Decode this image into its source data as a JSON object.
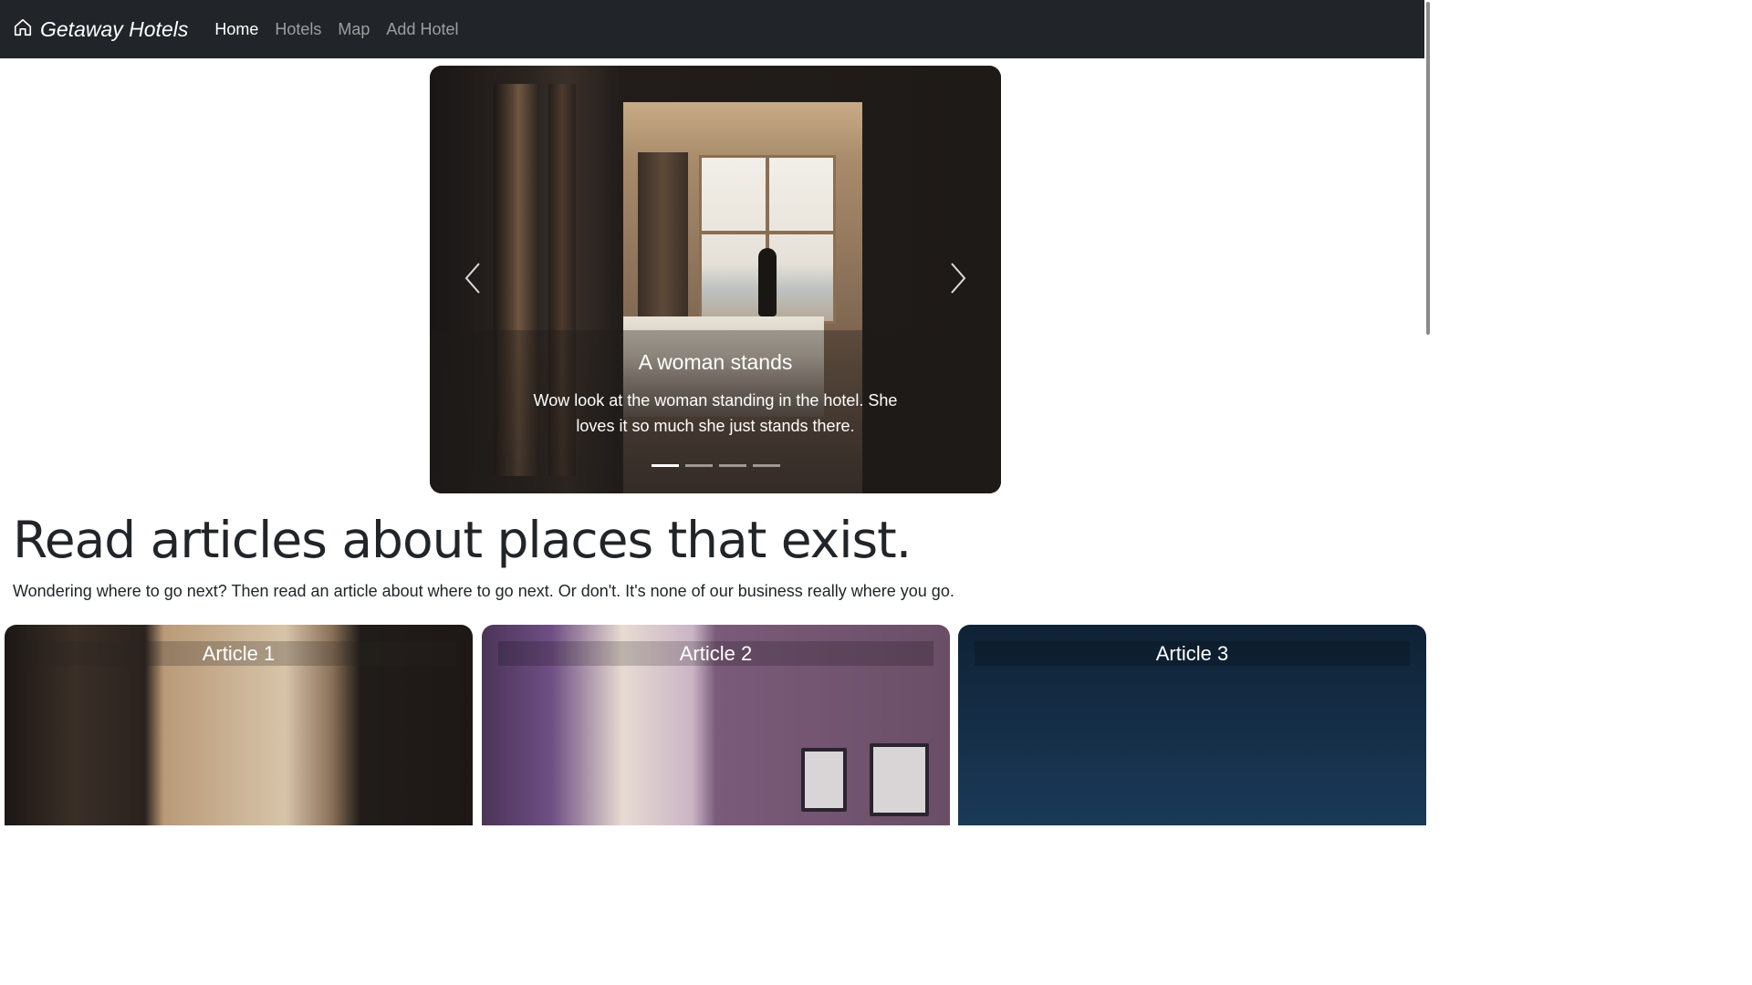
{
  "navbar": {
    "brand": "Getaway Hotels",
    "brand_icon": "house-icon",
    "links": [
      "Home",
      "Hotels",
      "Map",
      "Add Hotel"
    ],
    "active": "Home"
  },
  "carousel": {
    "caption_title": "A woman stands",
    "caption_text": "Wow look at the woman standing in the hotel. She loves it so much she just stands there.",
    "prev_icon": "chevron-left-icon",
    "next_icon": "chevron-right-icon",
    "slide_count": 4,
    "active_slide": 1
  },
  "hero": {
    "title": "Read articles about places that exist.",
    "subtitle": "Wondering where to go next? Then read an article about where to go next. Or don't. It's none of our business really where you go."
  },
  "articles": [
    {
      "title": "Article 1"
    },
    {
      "title": "Article 2"
    },
    {
      "title": "Article 3"
    }
  ],
  "colors": {
    "navbar_bg": "#212529",
    "nav_link_active": "#ffffff",
    "nav_link_inactive": "#8c8f92"
  }
}
